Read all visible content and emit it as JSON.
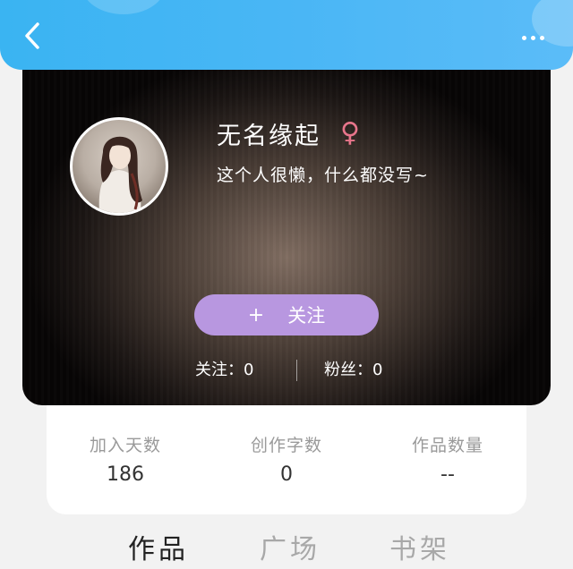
{
  "header": {
    "back_icon": "chevron-left-icon",
    "more_icon": "more-dots-icon"
  },
  "profile": {
    "nickname": "无名缘起",
    "gender_symbol": "♀",
    "bio": "这个人很懒，什么都没写~",
    "follow_plus": "+",
    "follow_label": "关注",
    "following_text": "关注：0",
    "fans_text": "粉丝：0"
  },
  "info": [
    {
      "label": "加入天数",
      "value": "186"
    },
    {
      "label": "创作字数",
      "value": "0"
    },
    {
      "label": "作品数量",
      "value": "--"
    }
  ],
  "tabs": [
    {
      "label": "作品",
      "active": true
    },
    {
      "label": "广场",
      "active": false
    },
    {
      "label": "书架",
      "active": false
    }
  ],
  "colors": {
    "header_blue": "#45b5f4",
    "follow_button": "#b897e0",
    "gender_pink": "#e7758b"
  }
}
